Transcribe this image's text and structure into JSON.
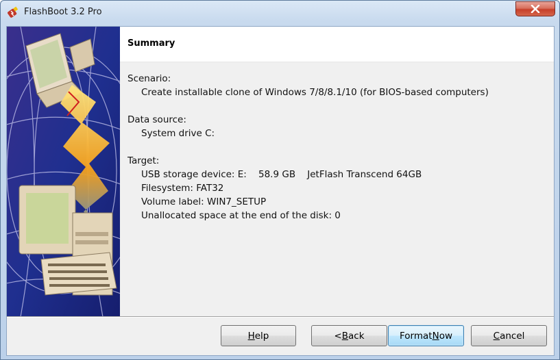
{
  "window": {
    "title": "FlashBoot 3.2 Pro",
    "close_label": "×"
  },
  "header": {
    "title": "Summary"
  },
  "summary": {
    "scenario_label": "Scenario:",
    "scenario_value": "Create installable clone of Windows 7/8/8.1/10 (for BIOS-based computers)",
    "data_source_label": "Data source:",
    "data_source_value": "System drive C:",
    "target_label": "Target:",
    "target_lines": [
      "USB storage device: E:    58.9 GB    JetFlash Transcend 64GB",
      "Filesystem: FAT32",
      "Volume label: WIN7_SETUP",
      "Unallocated space at the end of the disk: 0"
    ]
  },
  "buttons": {
    "help": {
      "pre": "",
      "mnemonic": "H",
      "post": "elp"
    },
    "back": {
      "pre": "< ",
      "mnemonic": "B",
      "post": "ack"
    },
    "format_now": {
      "pre": "Format ",
      "mnemonic": "N",
      "post": "ow"
    },
    "cancel": {
      "pre": "",
      "mnemonic": "C",
      "post": "ancel"
    }
  },
  "colors": {
    "accent": "#3c7fb1",
    "close_red": "#c7402a",
    "side_panel_blue": "#2a2a8a"
  },
  "icons": {
    "app": "flashboot-usb-icon",
    "close": "close-icon",
    "side": "computers-data-transfer-illustration"
  }
}
